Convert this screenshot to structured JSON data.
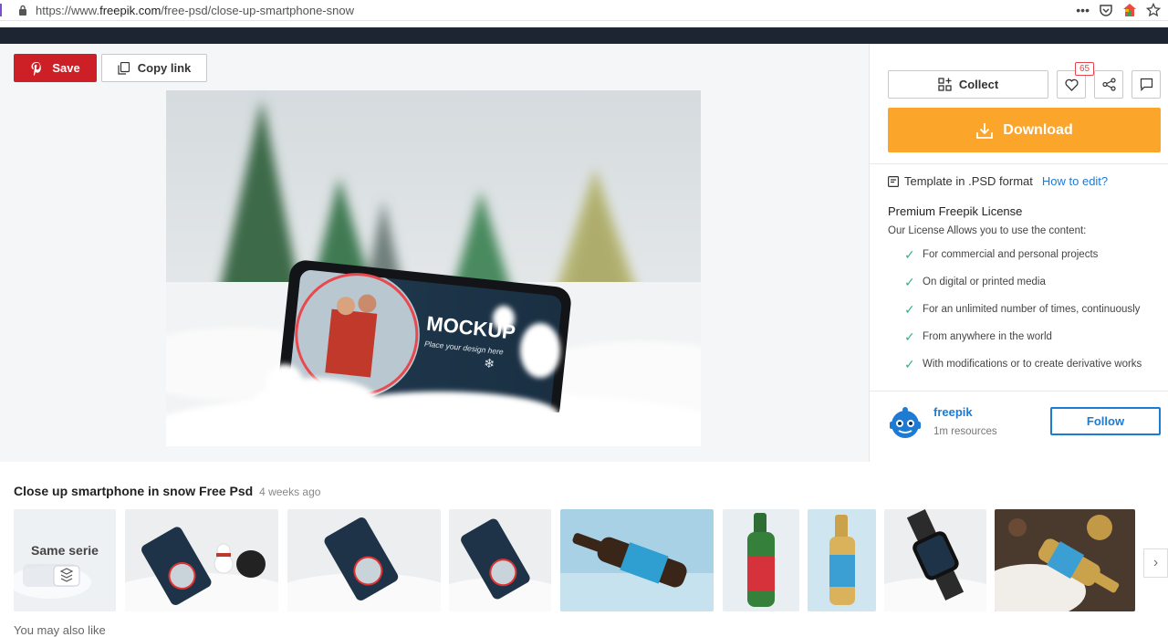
{
  "browser": {
    "url_prefix": "https://www.",
    "url_host": "freepik.com",
    "url_path": "/free-psd/close-up-smartphone-snow"
  },
  "actions": {
    "save_label": "Save",
    "copy_label": "Copy link",
    "collect_label": "Collect",
    "like_count": "65",
    "download_label": "Download"
  },
  "mockup": {
    "title": "MOCKUP",
    "tagline": "Place your design here"
  },
  "info": {
    "format_text": "Template in .PSD format",
    "how_to_edit": "How to edit?",
    "license_title": "Premium Freepik License",
    "license_sub": "Our License Allows you to use the content:",
    "license_items": [
      "For commercial and personal projects",
      "On digital or printed media",
      "For an unlimited number of times, continuously",
      "From anywhere in the world",
      "With modifications or to create derivative works"
    ]
  },
  "author": {
    "name": "freepik",
    "resources": "1m resources",
    "follow_label": "Follow"
  },
  "resource": {
    "title": "Close up smartphone in snow Free Psd",
    "age": "4 weeks ago"
  },
  "related": {
    "same_serie_label": "Same serie",
    "you_may_also_like": "You may also like"
  },
  "colors": {
    "save_red": "#cc1f26",
    "download_orange": "#fba52a",
    "link_blue": "#1d7bd3",
    "check_green": "#34b27a"
  }
}
